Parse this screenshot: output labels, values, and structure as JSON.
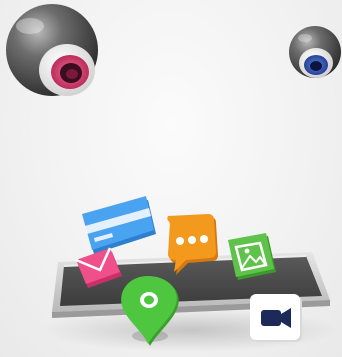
{
  "scene": {
    "description_colors": {
      "background": "#f3f3f3",
      "sphere_shell": "#4a4a4a",
      "left_iris": "#d43a6e",
      "right_iris": "#2e4fae",
      "belt": "#4b4b4b",
      "belt_frame": "#d2d2d2"
    },
    "icons": [
      {
        "name": "credit-card-icon",
        "color": "#4aa3f0"
      },
      {
        "name": "chat-bubble-icon",
        "color": "#f39a1e"
      },
      {
        "name": "image-icon",
        "color": "#5fc24a"
      },
      {
        "name": "envelope-icon",
        "color": "#f0508a"
      },
      {
        "name": "map-pin-icon",
        "color": "#4fc640"
      },
      {
        "name": "video-camera-icon",
        "color": "#ffffff"
      }
    ]
  }
}
